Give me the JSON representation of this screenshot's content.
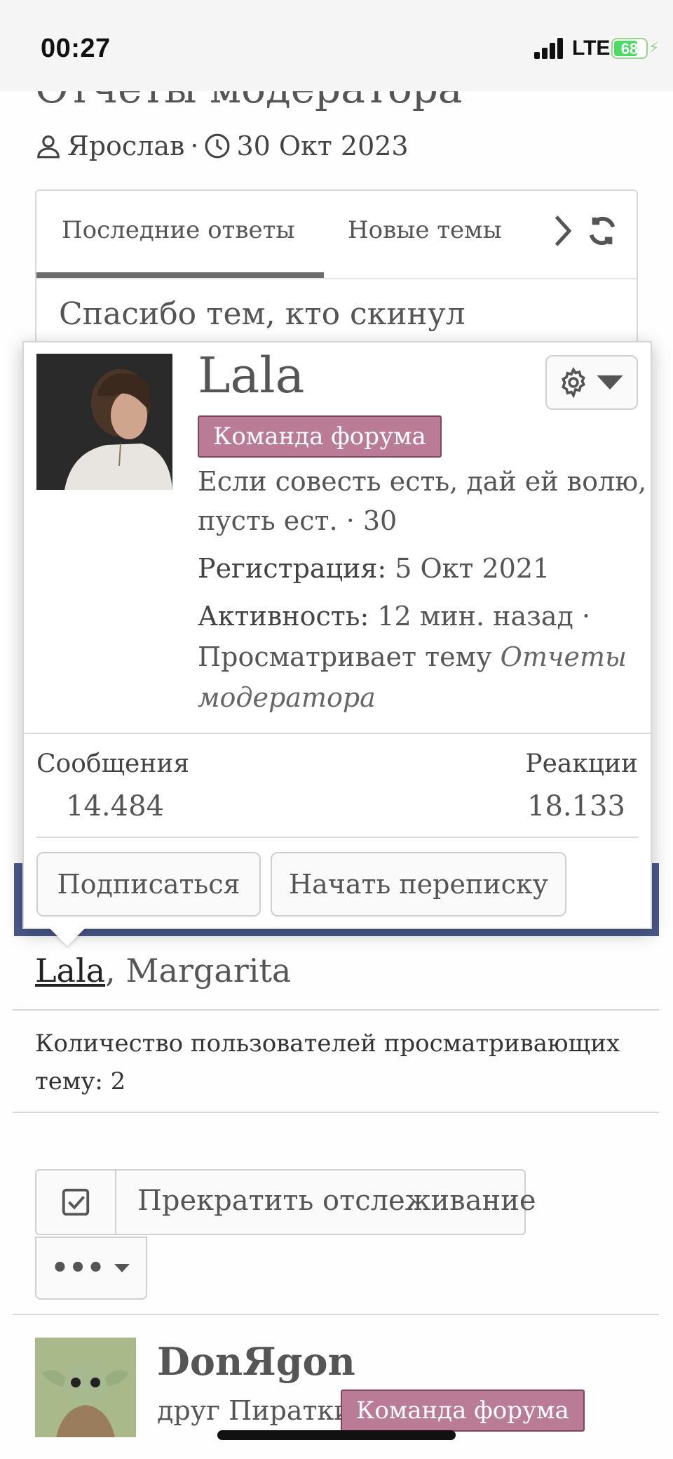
{
  "status_bar": {
    "time": "00:27",
    "network": "LTE",
    "battery": "68",
    "battery_level": 0.68,
    "colors": {
      "battery": "#4cd964"
    }
  },
  "page": {
    "title": "Отчеты модератора",
    "author": "Ярослав",
    "separator": "·",
    "date": "30 Окт 2023"
  },
  "widget": {
    "tabs": [
      {
        "label": "Последние ответы",
        "active": true
      },
      {
        "label": "Новые темы",
        "active": false
      }
    ],
    "next_icon": "chevron-right-icon",
    "refresh_icon": "refresh-icon",
    "preview_text": "Спасибо тем, кто скинул"
  },
  "tooltip": {
    "username": "Lala",
    "badge": "Команда форума",
    "status_line1": "Если совесть есть, дай ей волю,",
    "status_line2": "пусть ест. · 30",
    "registration_label": "Регистрация:",
    "registration_value": "5 Окт 2021",
    "activity_label": "Активность:",
    "activity_value": "12 мин. назад ·",
    "activity_line2_prefix": "Просматривает тему",
    "activity_topic_part1": "Отчеты",
    "activity_topic_part2": "модератора",
    "stats": {
      "messages_label": "Сообщения",
      "messages_value": "14.484",
      "reactions_label": "Реакции",
      "reactions_value": "18.133"
    },
    "buttons": {
      "follow": "Подписаться",
      "message": "Начать переписку"
    },
    "gear_icon": "gear-icon",
    "colors": {
      "badge_bg": "#b97b96",
      "badge_border": "#7d4660"
    }
  },
  "viewers": {
    "names_first": "Lala",
    "names_rest": ", Margarita",
    "count_text": "Количество пользователей просматривающих тему: 2"
  },
  "watch": {
    "label": "Прекратить отслеживание",
    "icon": "checkbox-checked-icon",
    "more_label": "•••"
  },
  "post": {
    "author": "DonЯgon",
    "user_title": "друг Пиратки",
    "badge": "Команда форума"
  },
  "colors": {
    "blue_band": "#4a5a8d"
  }
}
